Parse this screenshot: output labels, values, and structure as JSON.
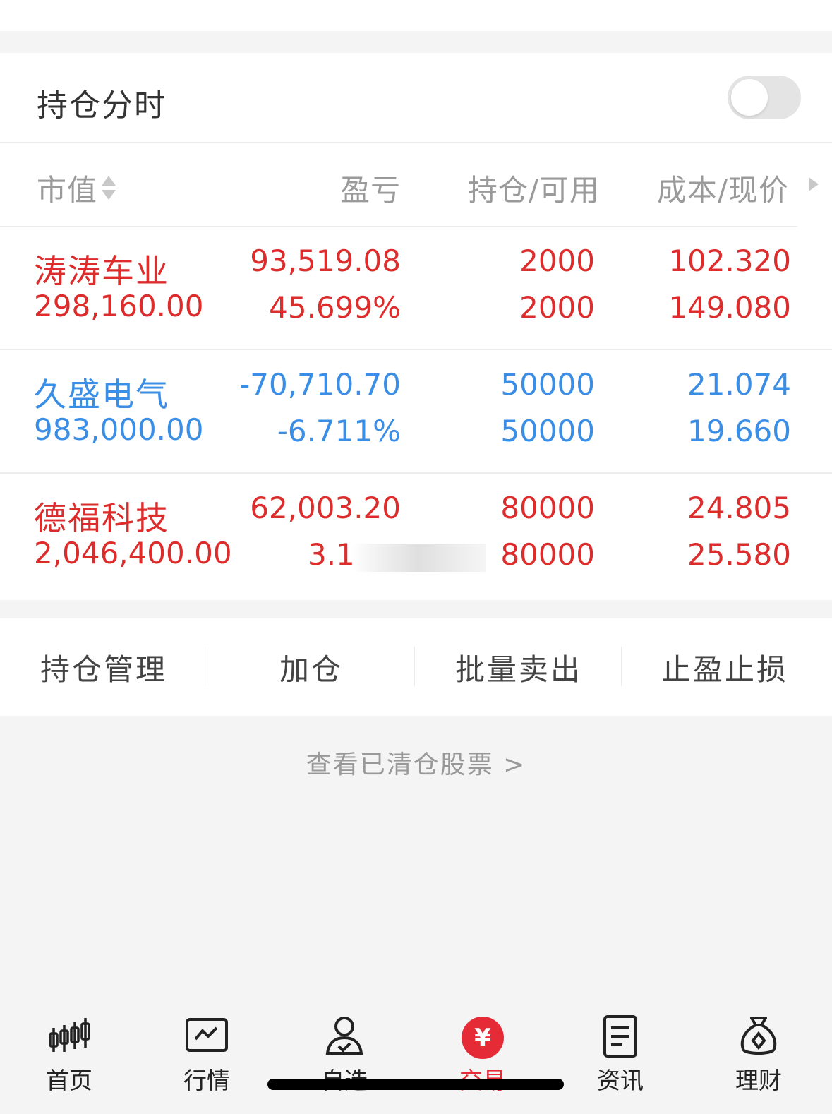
{
  "position_timeshare": {
    "label": "持仓分时",
    "toggle_on": false
  },
  "table": {
    "headers": {
      "market_value": "市值",
      "profit_loss": "盈亏",
      "position_available": "持仓/可用",
      "cost_price": "成本/现价"
    },
    "rows": [
      {
        "name": "涛涛车业",
        "market_value": "298,160.00",
        "profit_loss": "93,519.08",
        "profit_loss_pct": "45.699%",
        "position": "2000",
        "available": "2000",
        "cost": "102.320",
        "price": "149.080",
        "color": "#dd2c2c"
      },
      {
        "name": "久盛电气",
        "market_value": "983,000.00",
        "profit_loss": "-70,710.70",
        "profit_loss_pct": "-6.711%",
        "position": "50000",
        "available": "50000",
        "cost": "21.074",
        "price": "19.660",
        "color": "#3a8ee6"
      },
      {
        "name": "德福科技",
        "market_value": "2,046,400.00",
        "profit_loss": "62,003.20",
        "profit_loss_pct": "3.1",
        "position": "80000",
        "available": "80000",
        "cost": "24.805",
        "price": "25.580",
        "color": "#dd2c2c"
      }
    ]
  },
  "actions": {
    "manage": "持仓管理",
    "add": "加仓",
    "batch_sell": "批量卖出",
    "take_profit_stop_loss": "止盈止损"
  },
  "cleared_link": "查看已清仓股票 >",
  "tabbar": {
    "home": {
      "label": "首页",
      "icon": "candlestick-icon"
    },
    "market": {
      "label": "行情",
      "icon": "chart-icon"
    },
    "watchlist": {
      "label": "自选",
      "icon": "user-check-icon"
    },
    "trade": {
      "label": "交易",
      "icon": "yen-icon",
      "glyph": "¥"
    },
    "news": {
      "label": "资讯",
      "icon": "document-icon"
    },
    "wealth": {
      "label": "理财",
      "icon": "money-bag-icon"
    }
  }
}
